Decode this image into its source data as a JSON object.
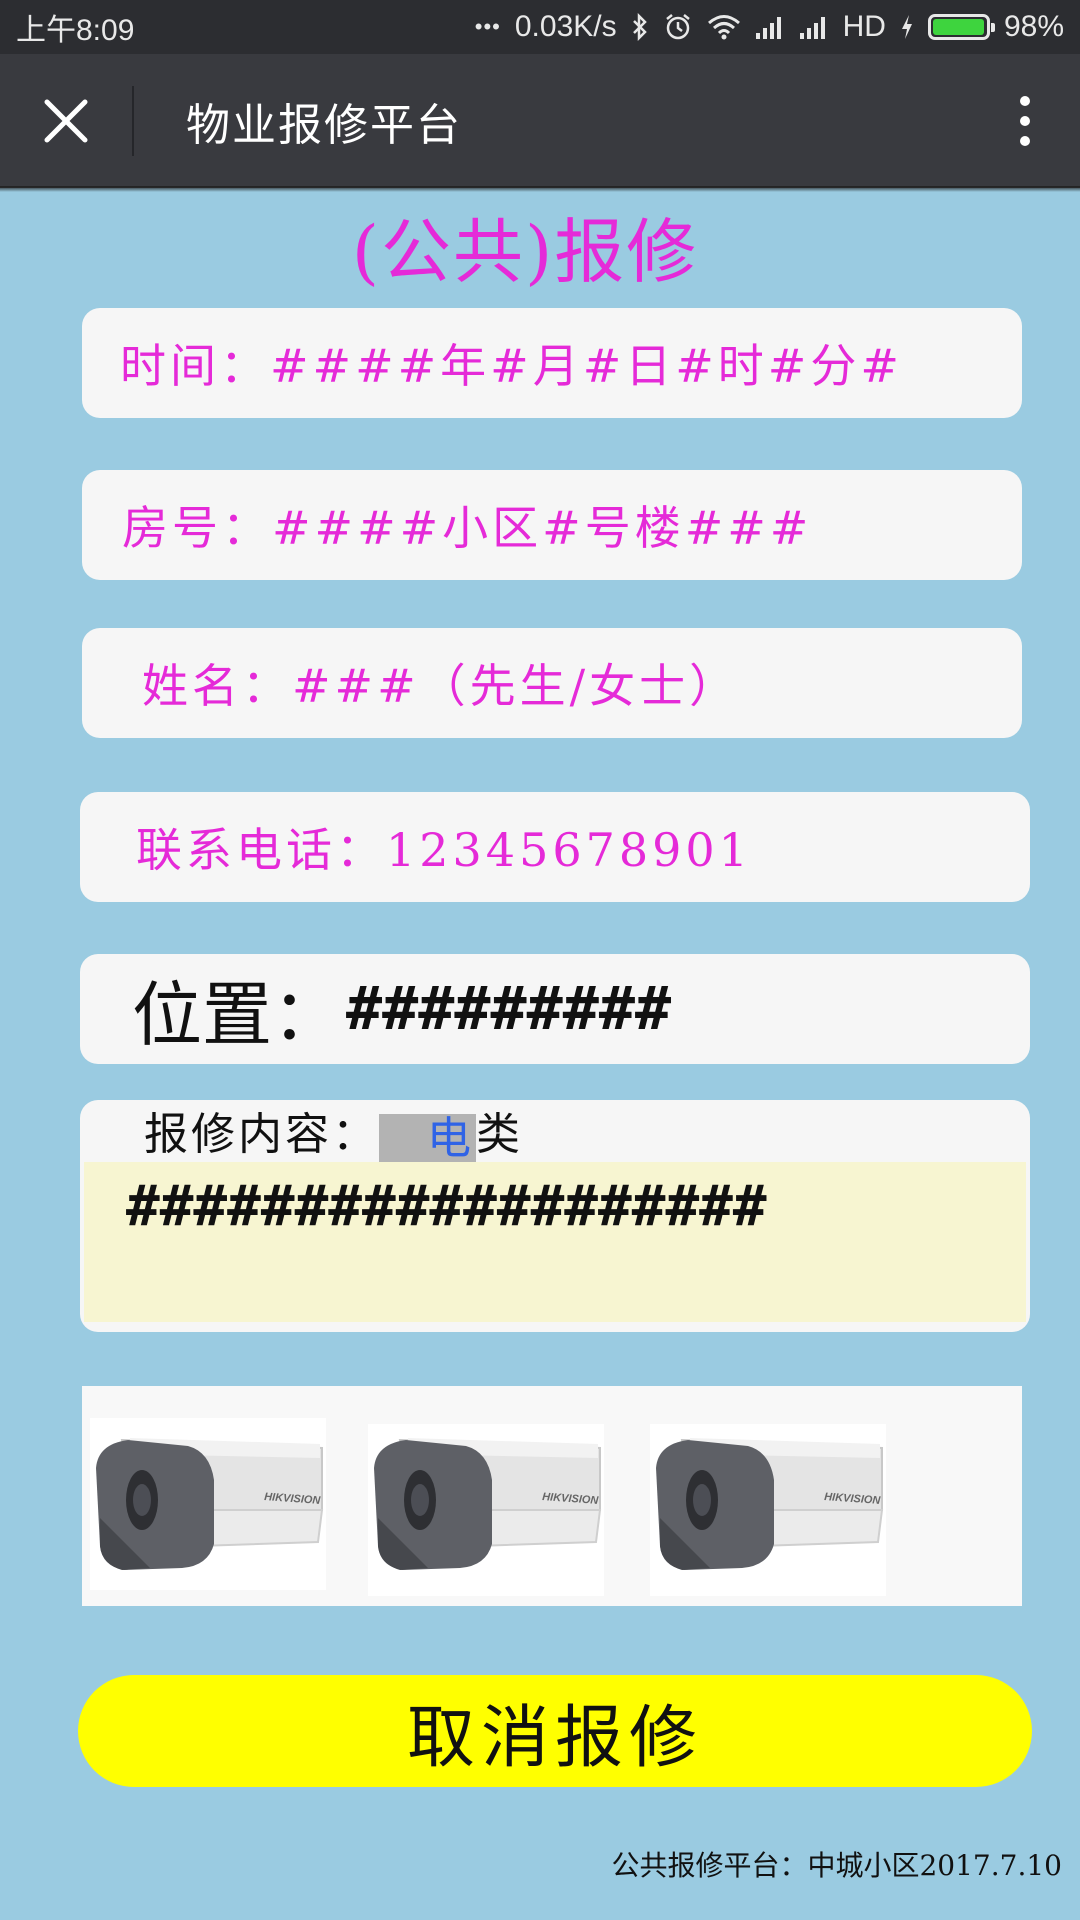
{
  "status_bar": {
    "time": "上午8:09",
    "dots": "•••",
    "net_speed": "0.03K/s",
    "hd": "HD",
    "battery_percent": "98%",
    "battery_level": 0.98,
    "icons": [
      "bluetooth-icon",
      "alarm-icon",
      "wifi-icon",
      "signal-icon",
      "signal-icon",
      "charging-icon",
      "battery-icon"
    ]
  },
  "nav": {
    "title": "物业报修平台",
    "close_icon": "close-icon",
    "more_icon": "more-vertical-icon"
  },
  "heading": "(公共)报修",
  "fields": {
    "time": "时间：####年#月#日#时#分#",
    "room": "房号：####小区#号楼###",
    "name": "姓名：###（先生/女士）",
    "phone": "联系电话：12345678901",
    "location_label": "位置：",
    "location_value": "#########"
  },
  "repair": {
    "label": "报修内容：",
    "category_highlight": "电",
    "category_rest": "类",
    "content": "###################"
  },
  "photos": [
    {
      "brand": "HIKVISION"
    },
    {
      "brand": "HIKVISION"
    },
    {
      "brand": "HIKVISION"
    }
  ],
  "cancel_button": "取消报修",
  "footer": "公共报修平台：中城小区2017.7.10",
  "colors": {
    "background": "#9acbe1",
    "accent_text": "#e52ad8",
    "button": "#ffff00",
    "content_bg": "#f7f5d1"
  }
}
